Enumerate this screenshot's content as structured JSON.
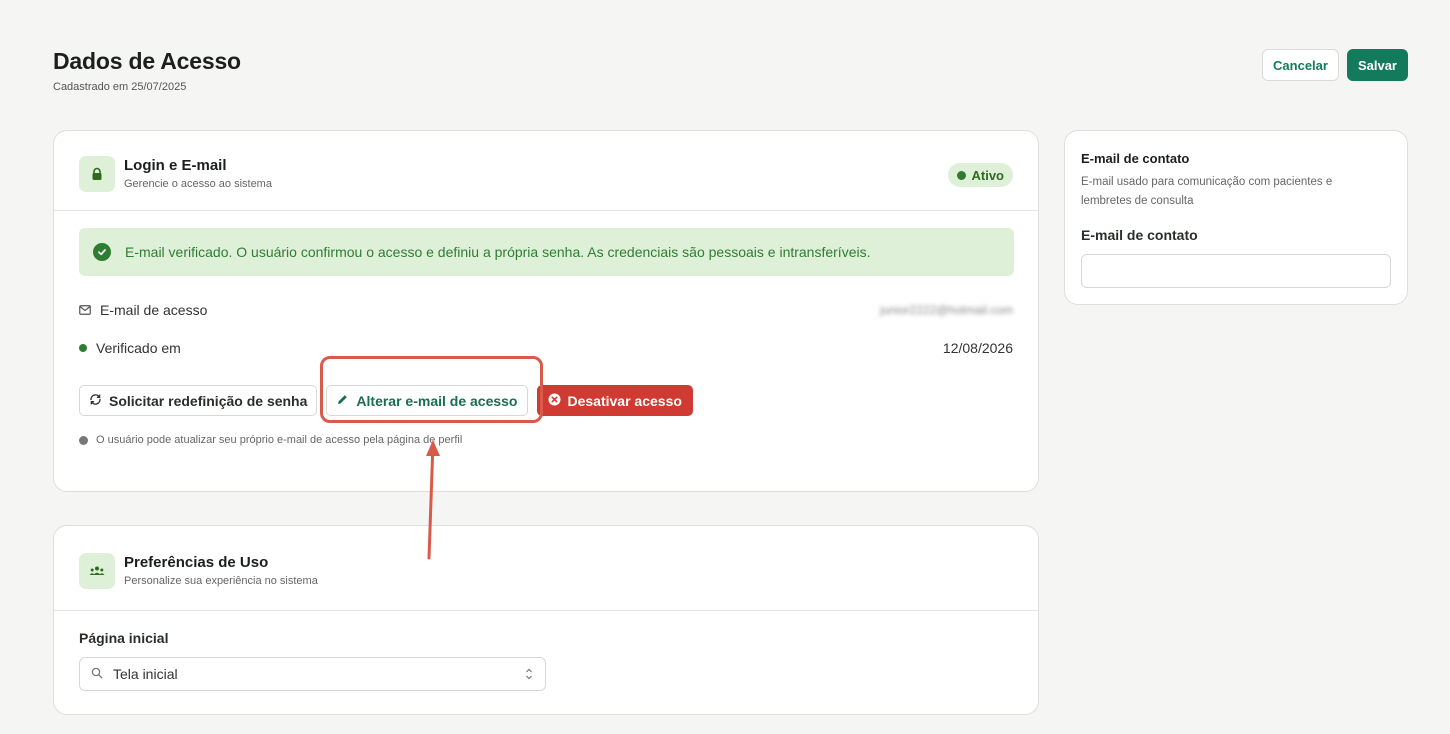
{
  "header": {
    "title": "Dados de Acesso",
    "subtitle": "Cadastrado em 25/07/2025",
    "cancel_label": "Cancelar",
    "save_label": "Salvar"
  },
  "login_card": {
    "icon": "lock-icon",
    "title": "Login e E-mail",
    "description": "Gerencie o acesso ao sistema",
    "status_badge": "Ativo",
    "alert_text": "E-mail verificado. O usuário confirmou o acesso e definiu a própria senha. As credenciais são pessoais e intransferíveis.",
    "email_label": "E-mail de acesso",
    "email_value": "junior2222@hotmail.com",
    "verified_label": "Verificado em",
    "verified_date": "12/08/2026",
    "buttons": {
      "reset_password": "Solicitar redefinição de senha",
      "change_email": "Alterar e-mail de acesso",
      "deactivate": "Desativar acesso"
    },
    "info_note": "O usuário pode atualizar seu próprio e-mail de acesso pela página de perfil"
  },
  "prefs_card": {
    "icon": "users-icon",
    "title": "Preferências de Uso",
    "description": "Personalize sua experiência no sistema",
    "home_page_label": "Página inicial",
    "home_page_value": "Tela inicial"
  },
  "contact_card": {
    "title": "E-mail de contato",
    "description": "E-mail usado para comunicação com pacientes e lembretes de consulta",
    "field_label": "E-mail de contato",
    "field_value": ""
  },
  "colors": {
    "brand": "#137a5b",
    "success_bg": "#dff0d8",
    "success_text": "#2e7d32",
    "danger": "#cf3b32",
    "annotation": "#d85b49"
  }
}
